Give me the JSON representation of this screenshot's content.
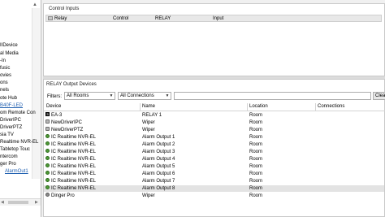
{
  "tree": {
    "items": [
      {
        "label": "IIDevice",
        "style": "normal"
      },
      {
        "label": "al Media",
        "style": "normal"
      },
      {
        "label": "-In",
        "style": "normal"
      },
      {
        "label": "fusic",
        "style": "normal"
      },
      {
        "label": "ovies",
        "style": "normal"
      },
      {
        "label": "ons",
        "style": "normal"
      },
      {
        "label": "nels",
        "style": "normal"
      },
      {
        "label": "B40F-LED",
        "style": "link"
      },
      {
        "label": "ote Hub",
        "style": "normal"
      },
      {
        "label": "om Remote Con",
        "style": "normal"
      },
      {
        "label": "DriverIPC",
        "style": "normal"
      },
      {
        "label": "DriverPTZ",
        "style": "normal"
      },
      {
        "label": "sia TV",
        "style": "normal"
      },
      {
        "label": "Realtime NVR-EL",
        "style": "normal"
      },
      {
        "label": "Tabletop Touc",
        "style": "normal"
      },
      {
        "label": "ntercom",
        "style": "normal"
      },
      {
        "label": "ger Pro",
        "style": "normal"
      },
      {
        "label": "AlarmOut1",
        "style": "link"
      }
    ]
  },
  "control_inputs": {
    "title": "Control Inputs",
    "row": {
      "name": "Relay",
      "type": "Control",
      "kind": "RELAY",
      "direction": "Input"
    }
  },
  "relay_outputs": {
    "title": "RELAY Output Devices",
    "filters_label": "Filters:",
    "room_filter": "All Rooms",
    "connection_filter": "All Connections",
    "search_value": "",
    "clear_label": "Clear",
    "columns": {
      "device": "Device",
      "name": "Name",
      "location": "Location",
      "connections": "Connections"
    },
    "rows": [
      {
        "device": "EA-3",
        "name": "RELAY 1",
        "location": "Room",
        "icon": "ea3-icon"
      },
      {
        "device": "NewDriverIPC",
        "name": "Wiper",
        "location": "Room",
        "icon": "camera-icon"
      },
      {
        "device": "NewDriverPTZ",
        "name": "Wiper",
        "location": "Room",
        "icon": "camera-icon"
      },
      {
        "device": "IC Realtime NVR-EL",
        "name": "Alarm Output 1",
        "location": "Room",
        "icon": "nvr-icon"
      },
      {
        "device": "IC Realtime NVR-EL",
        "name": "Alarm Output 2",
        "location": "Room",
        "icon": "nvr-icon"
      },
      {
        "device": "IC Realtime NVR-EL",
        "name": "Alarm Output 3",
        "location": "Room",
        "icon": "nvr-icon"
      },
      {
        "device": "IC Realtime NVR-EL",
        "name": "Alarm Output 4",
        "location": "Room",
        "icon": "nvr-icon"
      },
      {
        "device": "IC Realtime NVR-EL",
        "name": "Alarm Output 5",
        "location": "Room",
        "icon": "nvr-icon"
      },
      {
        "device": "IC Realtime NVR-EL",
        "name": "Alarm Output 6",
        "location": "Room",
        "icon": "nvr-icon"
      },
      {
        "device": "IC Realtime NVR-EL",
        "name": "Alarm Output 7",
        "location": "Room",
        "icon": "nvr-icon"
      },
      {
        "device": "IC Realtime NVR-EL",
        "name": "Alarm Output 8",
        "location": "Room",
        "icon": "nvr-icon"
      },
      {
        "device": "Dinger Pro",
        "name": "Wiper",
        "location": "Room",
        "icon": "dinger-icon"
      }
    ]
  },
  "colors": {
    "link": "#1f5fb0",
    "highlight_row": "#e3e3e3",
    "nvr_icon": "#4f9a37"
  }
}
